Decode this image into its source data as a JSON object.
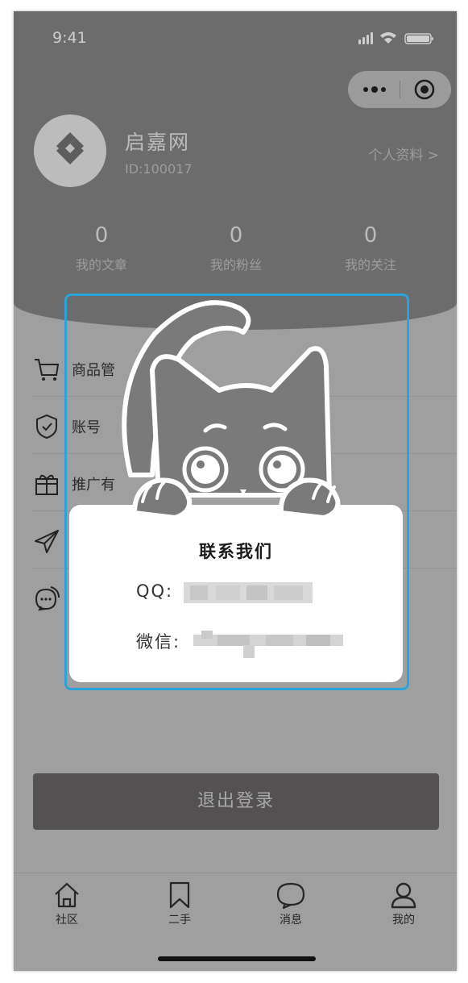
{
  "status_bar": {
    "time": "9:41"
  },
  "profile": {
    "name": "启嘉网",
    "id_text": "ID:100017",
    "profile_link": "个人资料 >"
  },
  "stats": [
    {
      "value": "0",
      "label": "我的文章"
    },
    {
      "value": "0",
      "label": "我的粉丝"
    },
    {
      "value": "0",
      "label": "我的关注"
    }
  ],
  "menu": [
    {
      "label": "商品管",
      "icon": "cart-icon"
    },
    {
      "label": "账号",
      "icon": "shield-icon"
    },
    {
      "label": "推广有",
      "icon": "gift-icon"
    },
    {
      "label": "",
      "icon": "send-icon"
    },
    {
      "label": "",
      "icon": "chat-icon"
    }
  ],
  "dialog": {
    "title": "联系我们",
    "qq_label": "QQ:",
    "wechat_label": "微信:"
  },
  "logout_label": "退出登录",
  "tabs": [
    {
      "label": "社区",
      "icon": "home-icon"
    },
    {
      "label": "二手",
      "icon": "bookmark-icon"
    },
    {
      "label": "消息",
      "icon": "message-icon"
    },
    {
      "label": "我的",
      "icon": "user-icon"
    }
  ],
  "colors": {
    "accent_border": "#29a3dc",
    "overlay_header": "#6d6c6d",
    "overlay_body": "#a09fa0"
  }
}
